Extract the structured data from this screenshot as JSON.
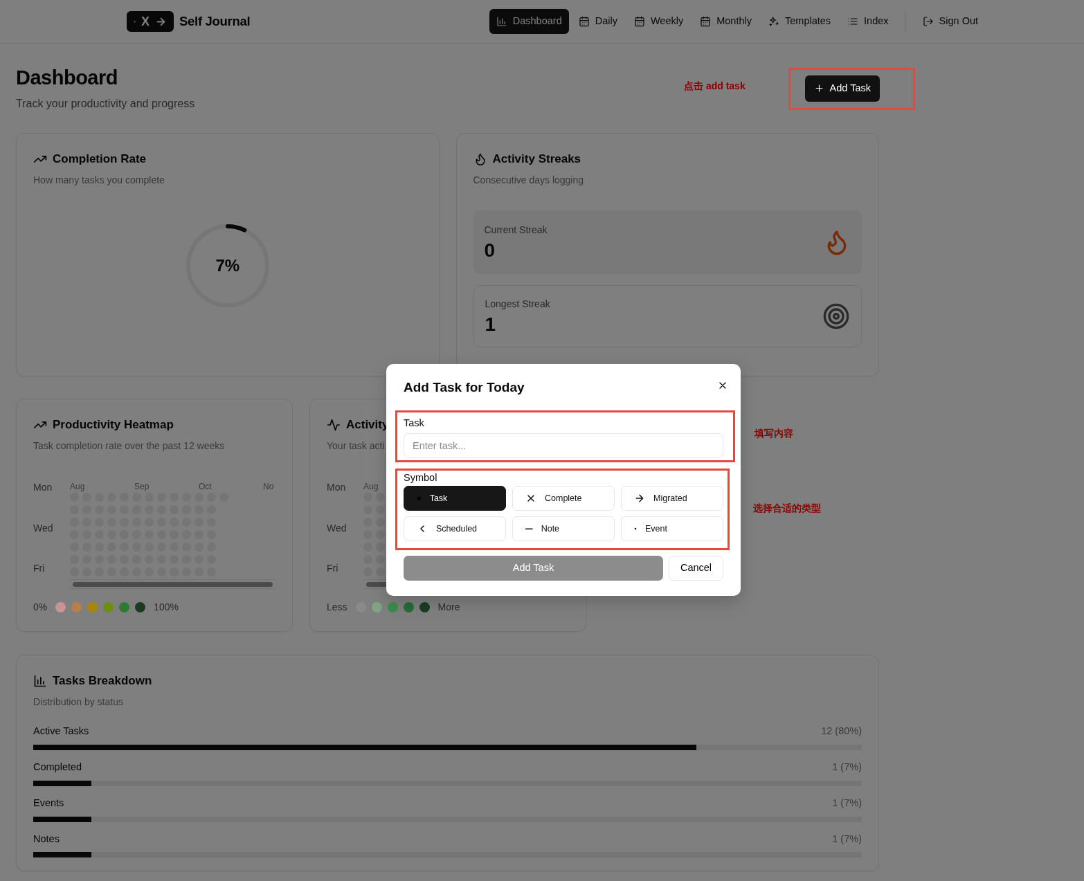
{
  "brand": {
    "logo_text": "X",
    "title": "Self Journal"
  },
  "nav": [
    {
      "label": "Dashboard",
      "kind": "chart",
      "selected": true
    },
    {
      "label": "Daily",
      "kind": "calendar",
      "selected": false
    },
    {
      "label": "Weekly",
      "kind": "calendar",
      "selected": false
    },
    {
      "label": "Monthly",
      "kind": "calendar",
      "selected": false
    },
    {
      "label": "Templates",
      "kind": "sparkles",
      "selected": false
    },
    {
      "label": "Index",
      "kind": "list",
      "selected": false
    }
  ],
  "sign_out": {
    "label": "Sign Out"
  },
  "header": {
    "title": "Dashboard",
    "subtitle": "Track your productivity and progress",
    "add_button": "Add Task",
    "note": "点击 add task"
  },
  "completion": {
    "title": "Completion Rate",
    "subtitle": "How many tasks you complete",
    "value": "7%",
    "level": 0.07
  },
  "streaks": {
    "title": "Activity Streaks",
    "subtitle": "Consecutive days logging",
    "items": [
      {
        "label": "Current Streak",
        "value": "0",
        "kind": "flame",
        "highlighted": true
      },
      {
        "label": "Longest Streak",
        "value": "1",
        "kind": "target",
        "highlighted": false
      }
    ]
  },
  "heatmap": {
    "title": "Productivity Heatmap",
    "subtitle": "Task completion rate over the past 12 weeks",
    "day_labels": [
      "Mon",
      "Wed",
      "Fri"
    ],
    "months": [
      "Aug",
      "Sep",
      "Oct",
      "No"
    ],
    "legend_start": "0%",
    "legend_end": "100%",
    "legend": [
      {
        "color": "#c99494"
      },
      {
        "color": "#b5804a"
      },
      {
        "color": "#a8860c"
      },
      {
        "color": "#6e8e12"
      },
      {
        "color": "#2f7a32"
      },
      {
        "color": "#1c3a22"
      }
    ]
  },
  "activity": {
    "title": "Activity",
    "subtitle": "Your task acti",
    "day_labels": [
      "Mon",
      "Wed",
      "Fri"
    ],
    "months": [
      "Aug"
    ],
    "legend_start": "Less",
    "legend_end": "More",
    "legend": [
      {
        "color": "#8a8a8a"
      },
      {
        "color": "#7fa584"
      },
      {
        "color": "#3c8c4c"
      },
      {
        "color": "#266c37"
      },
      {
        "color": "#193d22"
      }
    ]
  },
  "breakdown": {
    "title": "Tasks Breakdown",
    "subtitle": "Distribution by status",
    "rows": [
      {
        "label": "Active Tasks",
        "value": "12 (80%)",
        "level": 0.8
      },
      {
        "label": "Completed",
        "value": "1 (7%)",
        "level": 0.07
      },
      {
        "label": "Events",
        "value": "1 (7%)",
        "level": 0.07
      },
      {
        "label": "Notes",
        "value": "1 (7%)",
        "level": 0.07
      }
    ]
  },
  "modal": {
    "title": "Add Task for Today",
    "field_label": "Task",
    "placeholder": "Enter task...",
    "field_note": "填写内容",
    "symbol_label": "Symbol",
    "symbol_note": "选择合适的类型",
    "symbols": [
      {
        "label": "Task",
        "kind": "dot",
        "selected": true
      },
      {
        "label": "Complete",
        "kind": "cross",
        "selected": false
      },
      {
        "label": "Migrated",
        "kind": "arrow",
        "selected": false
      },
      {
        "label": "Scheduled",
        "kind": "chevron",
        "selected": false
      },
      {
        "label": "Note",
        "kind": "dash",
        "selected": false
      },
      {
        "label": "Event",
        "kind": "small-dot",
        "selected": false
      }
    ],
    "submit": "Add Task",
    "submit_disabled": true,
    "cancel": "Cancel"
  }
}
